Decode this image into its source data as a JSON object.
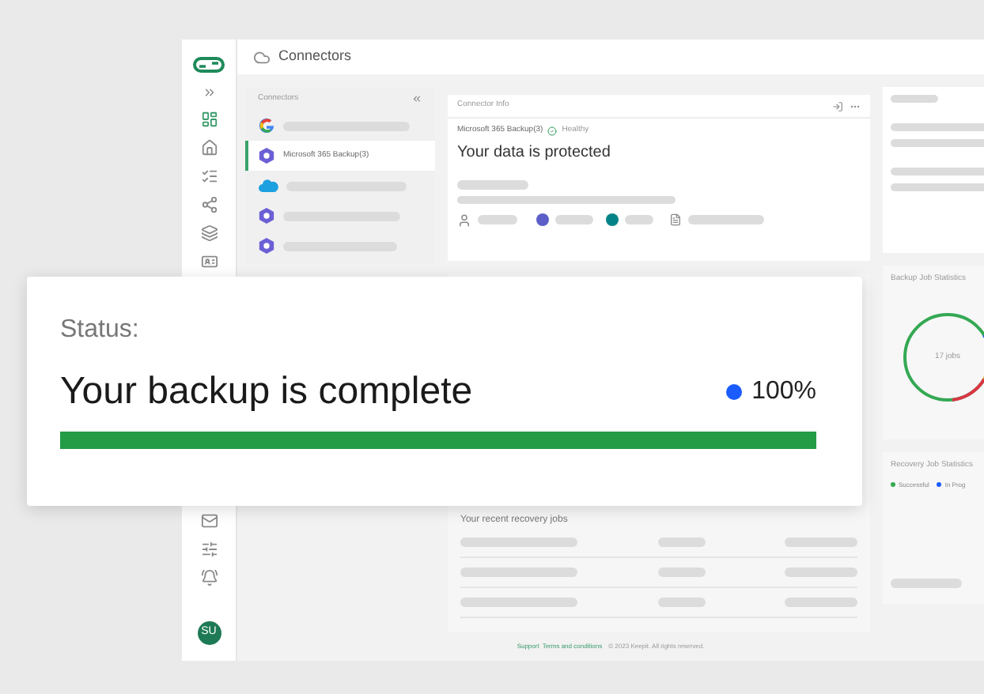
{
  "header": {
    "title": "Connectors"
  },
  "connectors_panel": {
    "title": "Connectors",
    "items": [
      {
        "kind": "google",
        "selected": false
      },
      {
        "kind": "microsoft",
        "label": "Microsoft 365 Backup(3)",
        "selected": true
      },
      {
        "kind": "salesforce",
        "selected": false
      },
      {
        "kind": "microsoft",
        "selected": false
      },
      {
        "kind": "microsoft",
        "selected": false
      }
    ]
  },
  "connector_info": {
    "title": "Connector Info",
    "name": "Microsoft 365 Backup(3)",
    "health": "Healthy",
    "headline": "Your data is protected"
  },
  "recovery_jobs": {
    "title": "Your recent recovery jobs"
  },
  "backup_stats": {
    "title": "Backup Job Statistics",
    "center_label": "17 jobs"
  },
  "recovery_stats": {
    "title": "Recovery Job Statistics",
    "legend": [
      {
        "label": "Successful",
        "color": "#34a853"
      },
      {
        "label": "In Prog",
        "color": "#1a5cff"
      }
    ]
  },
  "footer": {
    "links": [
      "Support",
      "Terms and conditions"
    ],
    "copyright": "© 2023 Keepit. All rights reserved."
  },
  "user": {
    "initials": "SU"
  },
  "status_card": {
    "label": "Status:",
    "message": "Your backup is complete",
    "percent": "100%",
    "level": 1
  }
}
